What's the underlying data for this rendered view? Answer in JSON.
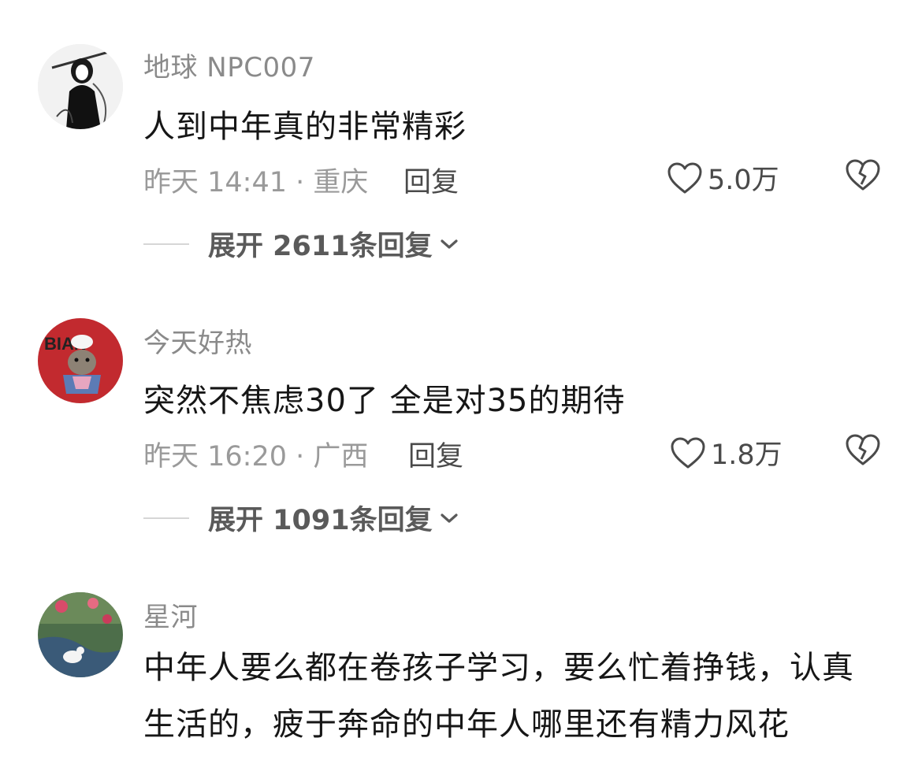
{
  "comments": [
    {
      "username": "地球 NPC007",
      "text": "人到中年真的非常精彩",
      "time_location": "昨天 14:41 · 重庆",
      "reply_label": "回复",
      "likes": "5.0万",
      "expand_label": "展开 2611条回复"
    },
    {
      "username": "今天好热",
      "text": "突然不焦虑30了 全是对35的期待",
      "time_location": "昨天 16:20 · 广西",
      "reply_label": "回复",
      "likes": "1.8万",
      "expand_label": "展开 1091条回复"
    },
    {
      "username": "星河",
      "text": "中年人要么都在卷孩子学习，要么忙着挣钱，认真生活的，疲于奔命的中年人哪里还有精力风花"
    }
  ],
  "icons": {
    "like": "heart-outline-icon",
    "dislike": "broken-heart-icon",
    "expand": "chevron-down-icon"
  },
  "colors": {
    "username": "#8a8a8a",
    "content": "#161616",
    "meta": "#9a9a9a",
    "action": "#4a4a4a"
  }
}
